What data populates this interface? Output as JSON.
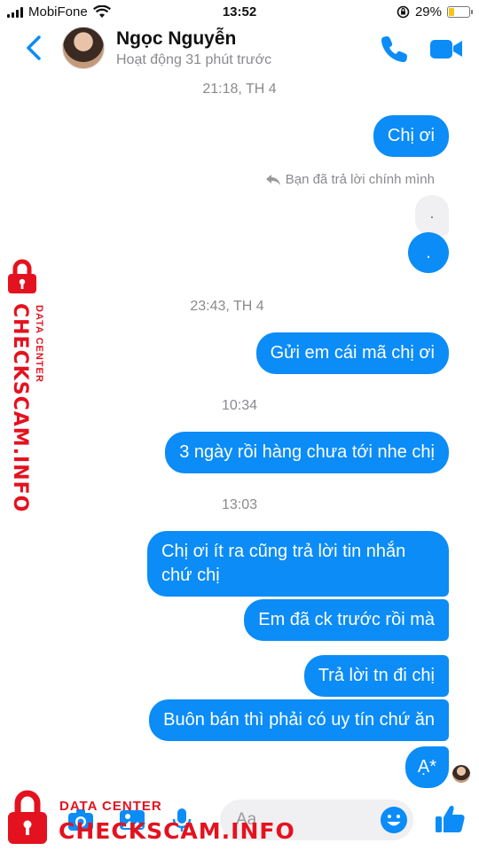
{
  "status_bar": {
    "carrier": "MobiFone",
    "time": "13:52",
    "battery_percent": "29%",
    "battery_level": 0.29,
    "icons": [
      "signal-icon",
      "wifi-icon",
      "orientation-lock-icon",
      "battery-icon"
    ]
  },
  "header": {
    "name": "Ngọc Nguyễn",
    "status": "Hoạt động 31 phút trước",
    "icons": [
      "back-chevron-icon",
      "phone-icon",
      "video-camera-icon"
    ]
  },
  "messages": {
    "ts1": "21:18, TH 4",
    "m1": "Chị ơi",
    "reply_note": "Bạn đã trả lời chính mình",
    "quoted_text": ".",
    "m2": ".",
    "ts2": "23:43, TH 4",
    "m3": "Gửi em cái mã chị ơi",
    "ts3": "10:34",
    "m4": "3 ngày rồi hàng chưa tới nhe chị",
    "ts4": "13:03",
    "m5": "Chị ơi ít ra cũng trả lời tin nhắn chứ chị",
    "m6": "Em đã ck trước rồi mà",
    "m7": "Trả lời tn đi chị",
    "m8": "Buôn bán thì phải có uy tín chứ ăn",
    "m9": "Ạ*"
  },
  "composer": {
    "placeholder": "Aa",
    "icons": [
      "camera-icon",
      "photo-icon",
      "microphone-icon",
      "emoji-icon",
      "thumbs-up-icon"
    ]
  },
  "watermark": {
    "text_small": "DATA CENTER",
    "text_big": "CHECKSCAM.INFO"
  },
  "colors": {
    "accent": "#0b8cf7",
    "watermark": "#e4121f",
    "timestamp": "#8a8a8e"
  }
}
